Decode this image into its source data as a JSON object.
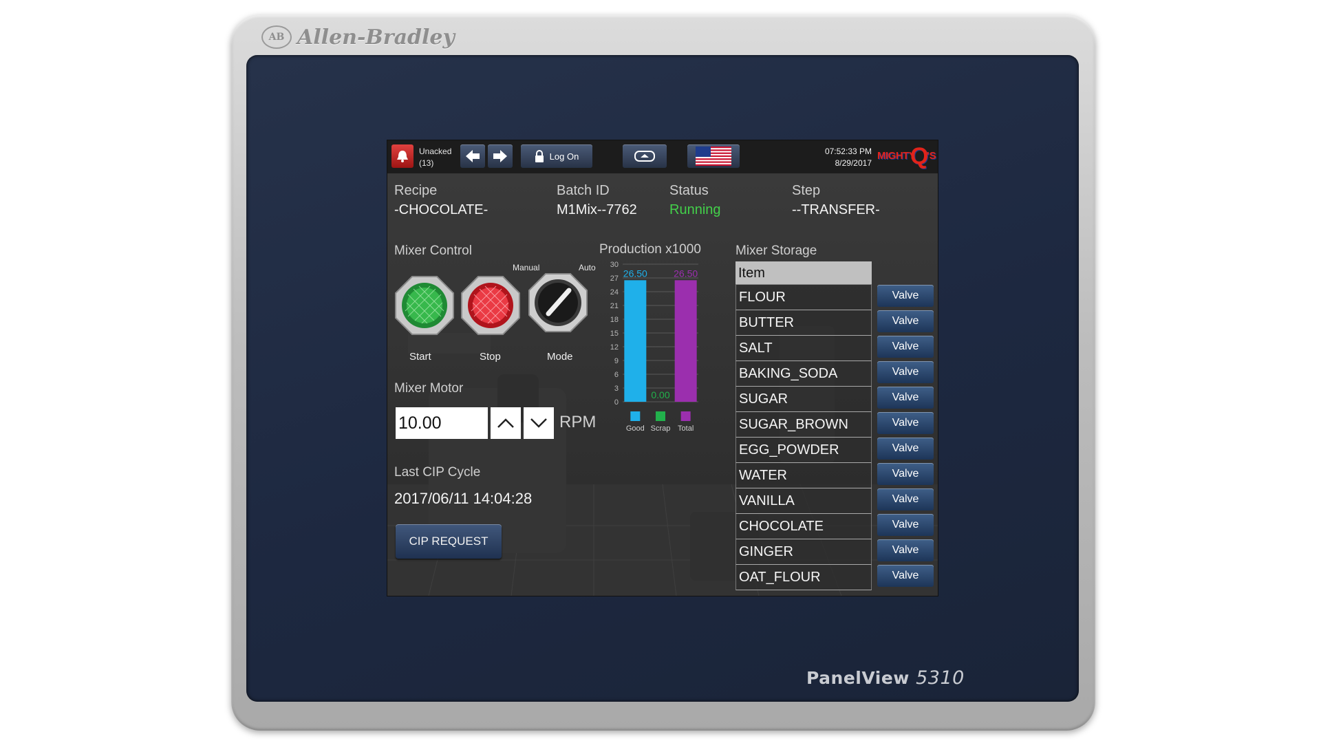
{
  "device": {
    "brand_logo": "AB",
    "brand_name": "Allen-Bradley",
    "model_name": "PanelView",
    "model_number": "5310"
  },
  "header": {
    "alarm_label": "Unacked",
    "alarm_count": "(13)",
    "logon_label": "Log On",
    "time": "07:52:33 PM",
    "date": "8/29/2017",
    "logo_text": "MIGHTY",
    "logo_q": "Q",
    "logo_s": "'S"
  },
  "info": {
    "recipe_label": "Recipe",
    "recipe_value": "-CHOCOLATE-",
    "batch_label": "Batch ID",
    "batch_value": "M1Mix--7762",
    "status_label": "Status",
    "status_value": "Running",
    "step_label": "Step",
    "step_value": "--TRANSFER-"
  },
  "mixer_control": {
    "title": "Mixer Control",
    "start_label": "Start",
    "stop_label": "Stop",
    "mode_label": "Mode",
    "manual_label": "Manual",
    "auto_label": "Auto"
  },
  "mixer_motor": {
    "title": "Mixer Motor",
    "value": "10.00",
    "unit": "RPM"
  },
  "cip": {
    "title": "Last CIP Cycle",
    "timestamp": "2017/06/11 14:04:28",
    "button_label": "CIP REQUEST"
  },
  "chart_data": {
    "type": "bar",
    "title": "Production x1000",
    "categories": [
      "Good",
      "Scrap",
      "Total"
    ],
    "values": [
      26.5,
      0.0,
      26.5
    ],
    "value_labels": [
      "26.50",
      "0.00",
      "26.50"
    ],
    "colors": [
      "#1fb0ea",
      "#22b14c",
      "#9b2fae"
    ],
    "ylim": [
      0,
      30
    ],
    "yticks": [
      0,
      3,
      6,
      9,
      12,
      15,
      18,
      21,
      24,
      27,
      30
    ],
    "grid": true
  },
  "storage": {
    "title": "Mixer Storage",
    "header": "Item",
    "items": [
      "FLOUR",
      "BUTTER",
      "SALT",
      "BAKING_SODA",
      "SUGAR",
      "SUGAR_BROWN",
      "EGG_POWDER",
      "WATER",
      "VANILLA",
      "CHOCOLATE",
      "GINGER",
      "OAT_FLOUR"
    ],
    "valve_label": "Valve"
  }
}
